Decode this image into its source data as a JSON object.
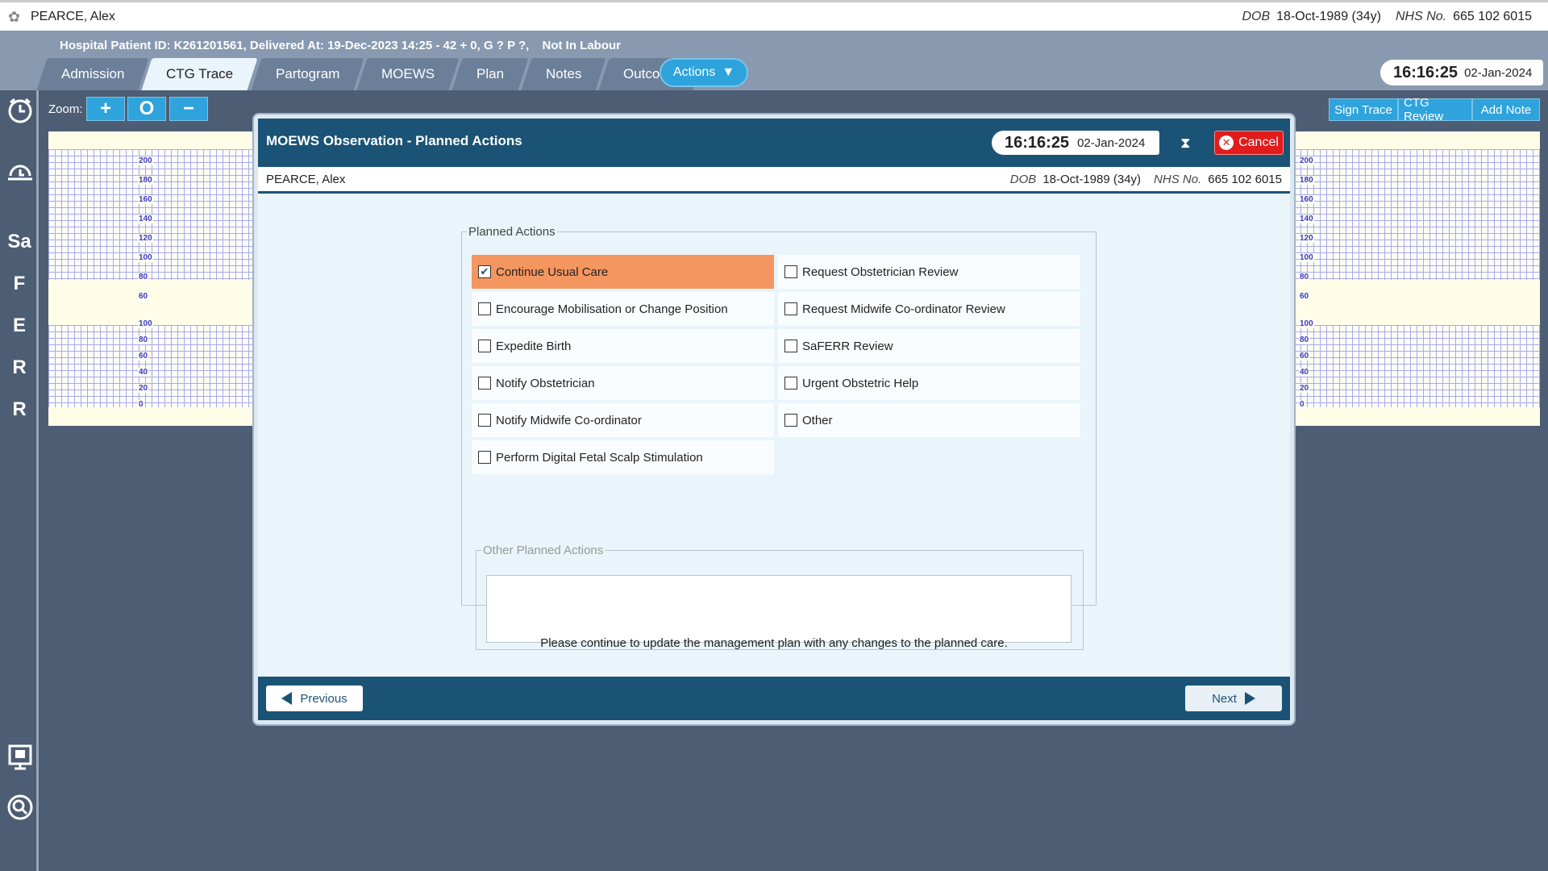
{
  "topbar": {
    "patient_name": "PEARCE, Alex",
    "dob_label": "DOB",
    "dob_value": "18-Oct-1989 (34y)",
    "nhs_label": "NHS No.",
    "nhs_value": "665 102 6015"
  },
  "header": {
    "hospital_id": "Hospital Patient ID: K261201561, Delivered At: 19-Dec-2023 14:25 - 42 + 0, G ? P ?,",
    "labour_status": "Not In Labour",
    "tabs": [
      {
        "label": "Admission"
      },
      {
        "label": "CTG Trace",
        "active": true
      },
      {
        "label": "Partogram"
      },
      {
        "label": "MOEWS"
      },
      {
        "label": "Plan"
      },
      {
        "label": "Notes"
      },
      {
        "label": "Outcome"
      }
    ],
    "actions_label": "Actions",
    "clock_time": "16:16:25",
    "clock_date": "02-Jan-2024"
  },
  "sidebar": {
    "items": [
      {
        "label": "Sa"
      },
      {
        "label": "F"
      },
      {
        "label": "E"
      },
      {
        "label": "R"
      },
      {
        "label": "R"
      }
    ]
  },
  "toolbar": {
    "zoom_label": "Zoom:",
    "zoom_in": "+",
    "zoom_reset": "O",
    "zoom_out": "−",
    "sign_trace": "Sign Trace",
    "ctg_review": "CTG Review",
    "add_note": "Add Note"
  },
  "ctg": {
    "fhr_ticks": [
      "200",
      "180",
      "160",
      "140",
      "120",
      "100",
      "80",
      "60"
    ],
    "toco_ticks": [
      "100",
      "80",
      "60",
      "40",
      "20",
      "0"
    ]
  },
  "modal": {
    "title": "MOEWS Observation - Planned Actions",
    "clock_time": "16:16:25",
    "clock_date": "02-Jan-2024",
    "cancel_label": "Cancel",
    "patient_name": "PEARCE, Alex",
    "dob_label": "DOB",
    "dob_value": "18-Oct-1989 (34y)",
    "nhs_label": "NHS No.",
    "nhs_value": "665 102 6015",
    "planned_actions_legend": "Planned Actions",
    "options": [
      {
        "label": "Continue Usual Care",
        "checked": true
      },
      {
        "label": "Request Obstetrician Review",
        "checked": false
      },
      {
        "label": "Encourage Mobilisation or Change Position",
        "checked": false
      },
      {
        "label": "Request Midwife Co-ordinator Review",
        "checked": false
      },
      {
        "label": "Expedite Birth",
        "checked": false
      },
      {
        "label": "SaFERR Review",
        "checked": false
      },
      {
        "label": "Notify Obstetrician",
        "checked": false
      },
      {
        "label": "Urgent Obstetric Help",
        "checked": false
      },
      {
        "label": "Notify Midwife Co-ordinator",
        "checked": false
      },
      {
        "label": "Other",
        "checked": false
      },
      {
        "label": "Perform Digital Fetal Scalp Stimulation",
        "checked": false
      }
    ],
    "other_legend": "Other Planned Actions",
    "other_value": "",
    "message": "Please continue to update the management plan with any changes to the planned care.",
    "previous_label": "Previous",
    "next_label": "Next"
  },
  "colors": {
    "header_bg": "#8899b0",
    "accent_blue": "#2ea3dc",
    "modal_dark": "#1a5375",
    "checked_option": "#f4965f",
    "cancel_red": "#e21b1b"
  }
}
